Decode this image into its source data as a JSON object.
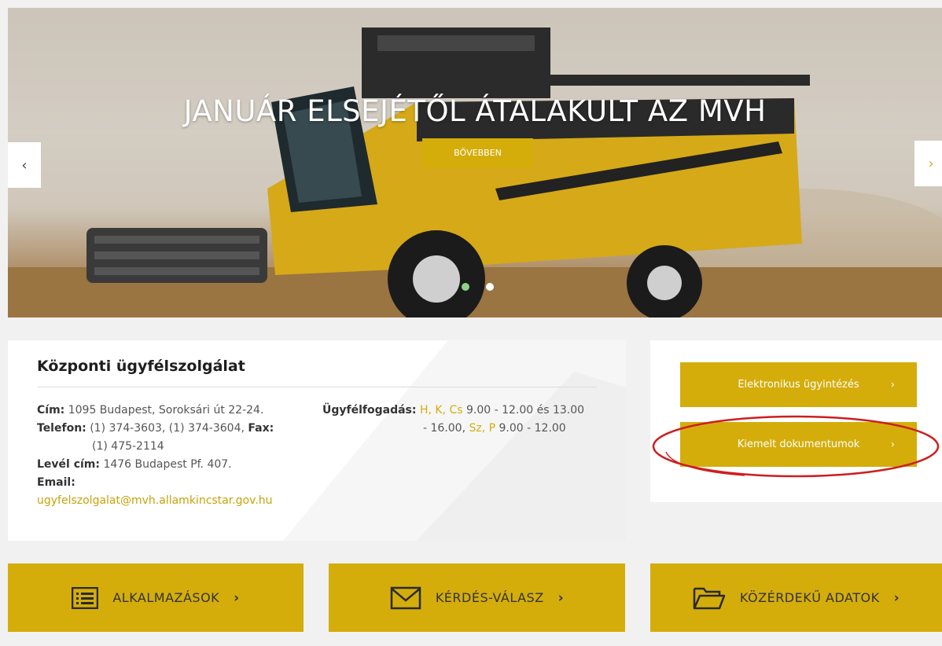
{
  "hero": {
    "title": "JANUÁR ELSEJÉTŐL ÁTALAKULT AZ MVH",
    "button_label": "BŐVEBBEN",
    "prev_glyph": "‹",
    "next_glyph": "›",
    "slides": 2,
    "active_slide": 1
  },
  "info": {
    "title": "Központi ügyfélszolgálat",
    "address_label": "Cím:",
    "address_value": "1095 Budapest, Soroksári út 22-24.",
    "phone_label": "Telefon:",
    "phone_value": "(1) 374-3603, (1) 374-3604,",
    "fax_label": "Fax:",
    "fax_value": "(1) 475-2114",
    "mail_label": "Levél cím:",
    "mail_value": "1476 Budapest Pf. 407.",
    "email_label": "Email:",
    "email_value": "ugyfelszolgalat@mvh.allamkincstar.gov.hu",
    "hours_label": "Ügyfélfogadás:",
    "hours_days1": "H, K, Cs",
    "hours_time1": "9.00 - 12.00 és 13.00",
    "hours_time1b": "- 16.00,",
    "hours_days2": "Sz, P",
    "hours_time2": "9.00 - 12.00"
  },
  "side": {
    "button1": "Elektronikus ügyintézés",
    "button2": "Kiemelt dokumentumok",
    "chevron": "›"
  },
  "tiles": [
    {
      "label": "ALKALMAZÁSOK",
      "icon": "list-icon"
    },
    {
      "label": "KÉRDÉS-VÁLASZ",
      "icon": "envelope-icon"
    },
    {
      "label": "KÖZÉRDEKŰ ADATOK",
      "icon": "folder-icon"
    }
  ],
  "tile_chevron": "›",
  "colors": {
    "accent": "#d4ad0b",
    "annotation": "#cc1f1f",
    "background": "#f1f1f1"
  }
}
